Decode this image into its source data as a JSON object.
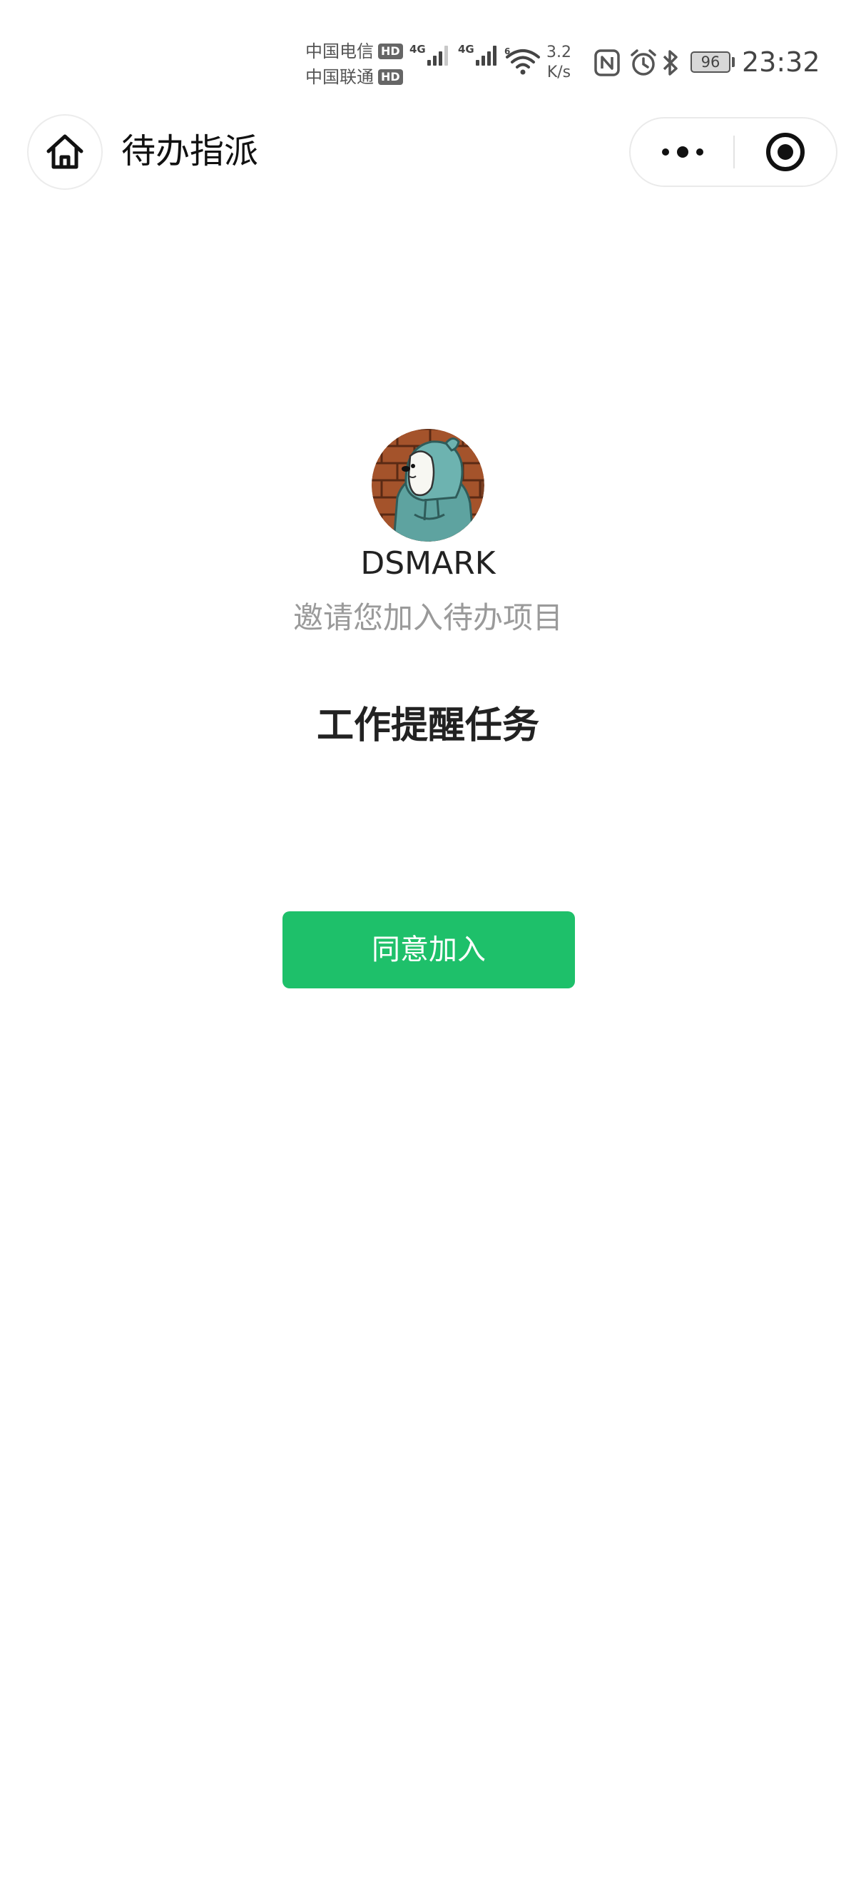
{
  "status_bar": {
    "carrier_1": "中国电信",
    "carrier_2": "中国联通",
    "hd_label": "HD",
    "network_1": "4G",
    "network_2": "4G",
    "wifi_badge": "6",
    "speed_value": "3.2",
    "speed_unit": "K/s",
    "battery_level": "96",
    "time": "23:32"
  },
  "nav": {
    "title": "待办指派"
  },
  "invite": {
    "inviter_name": "DSMARK",
    "message": "邀请您加入待办项目",
    "project_title": "工作提醒任务",
    "join_button_label": "同意加入"
  },
  "colors": {
    "accent_green": "#1ec06a",
    "secondary_text": "#9a9a9a"
  },
  "icons": {
    "home": "home-icon",
    "more": "more-dots-icon",
    "close": "target-close-icon",
    "avatar": "hooded-bear-avatar"
  }
}
